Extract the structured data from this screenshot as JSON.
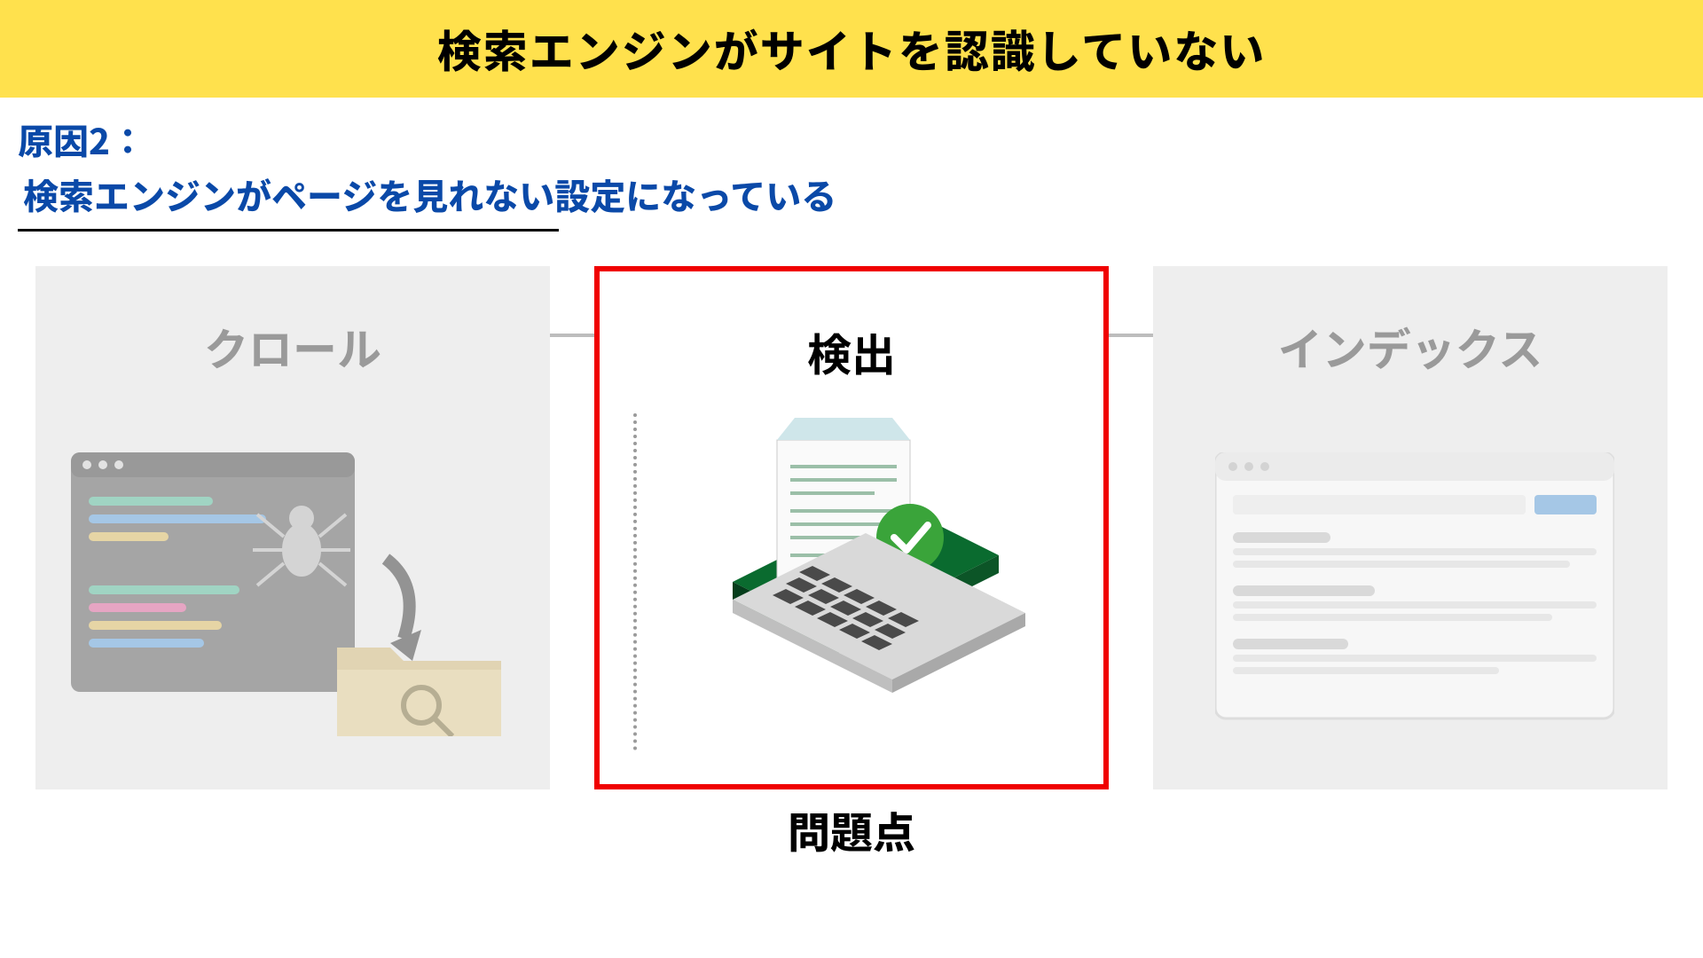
{
  "title": "検索エンジンがサイトを認識していない",
  "subtitle": {
    "line1": "原因2：",
    "line2": "検索エンジンがページを見れない設定になっている"
  },
  "steps": {
    "crawl": "クロール",
    "detect": "検出",
    "index": "インデックス"
  },
  "issue_label": "問題点",
  "colors": {
    "title_bg": "#ffe14d",
    "highlight_border": "#f00000",
    "subtitle": "#0a49a8"
  }
}
